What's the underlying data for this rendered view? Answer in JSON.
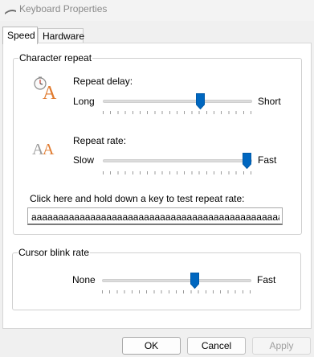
{
  "window": {
    "title": "Keyboard Properties",
    "icon": "keyboard-icon"
  },
  "tabs": [
    {
      "label": "Speed",
      "active": true
    },
    {
      "label": "Hardware",
      "active": false
    }
  ],
  "character_repeat": {
    "group_label": "Character repeat",
    "delay": {
      "label": "Repeat delay:",
      "min_label": "Long",
      "max_label": "Short",
      "value_fraction": 0.67,
      "icon": "repeat-delay-icon"
    },
    "rate": {
      "label": "Repeat rate:",
      "min_label": "Slow",
      "max_label": "Fast",
      "value_fraction": 1.0,
      "icon": "repeat-rate-icon"
    },
    "test_label": "Click here and hold down a key to test repeat rate:",
    "test_value": "aaaaaaaaaaaaaaaaaaaaaaaaaaaaaaaaaaaaaaaaaaaaaaaaaaaaaaaaaaaaaaaaaaaaaaaaaaaaaaaaaaa"
  },
  "cursor_blink": {
    "group_label": "Cursor blink rate",
    "min_label": "None",
    "max_label": "Fast",
    "value_fraction": 0.6
  },
  "buttons": {
    "ok": "OK",
    "cancel": "Cancel",
    "apply": "Apply"
  },
  "colors": {
    "accent": "#0067c0"
  }
}
